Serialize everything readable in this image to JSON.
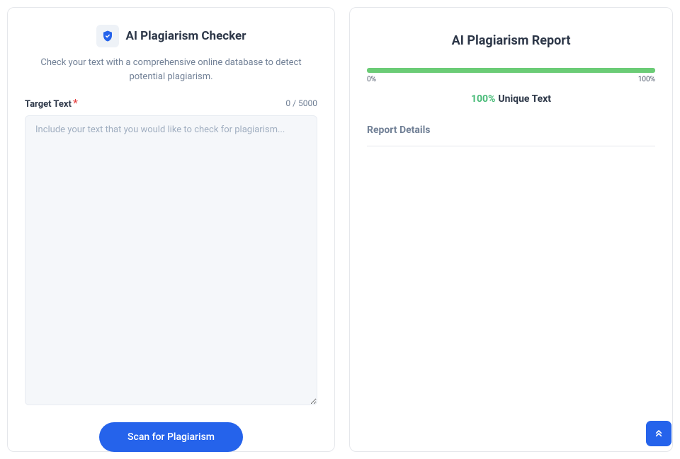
{
  "left": {
    "title": "AI Plagiarism Checker",
    "subtitle": "Check your text with a comprehensive online database to detect potential plagiarism.",
    "field_label": "Target Text",
    "char_count": "0 / 5000",
    "placeholder": "Include your text that you would like to check for plagiarism...",
    "button_label": "Scan for Plagiarism"
  },
  "right": {
    "title": "AI Plagiarism Report",
    "progress_min": "0%",
    "progress_max": "100%",
    "unique_percent": "100%",
    "unique_label": "Unique Text",
    "details_title": "Report Details"
  }
}
